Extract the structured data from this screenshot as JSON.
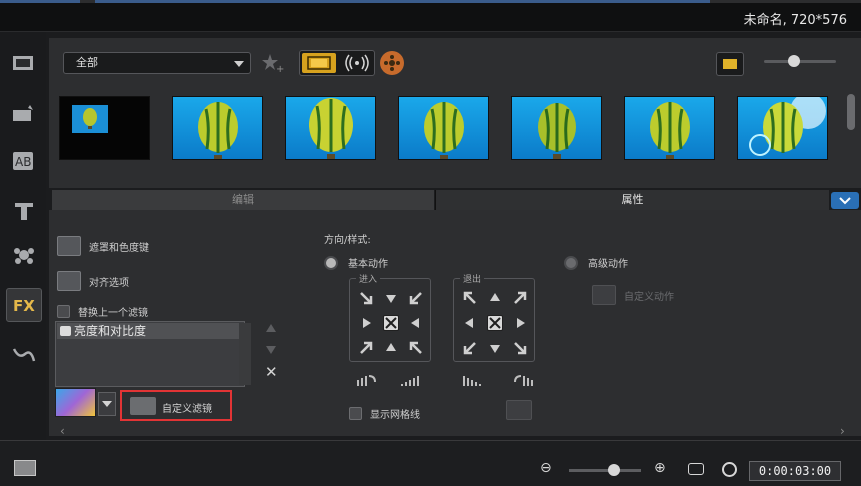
{
  "window": {
    "title": "未命名, 720*576"
  },
  "library": {
    "category": "全部",
    "icons": {
      "add_favorite": "star-plus-icon",
      "show_video": "film-icon",
      "show_audio": "audio-wave-icon",
      "show_graphics": "film-reel-icon",
      "toggle_view": "layout-icon"
    }
  },
  "tabs": {
    "edit": "编辑",
    "attributes": "属性"
  },
  "attributes": {
    "mask_chroma": "遮罩和色度键",
    "align_options": "对齐选项",
    "replace_last_filter": "替换上一个滤镜",
    "filter_item": "亮度和对比度",
    "custom_filter": "自定义滤镜",
    "direction_style": "方向/样式:",
    "basic_motion": "基本动作",
    "advanced_motion": "高级动作",
    "custom_motion": "自定义动作",
    "enter": "进入",
    "exit": "退出",
    "show_grid": "显示网格线"
  },
  "bottom": {
    "timecode": "0:00:03:00"
  },
  "colors": {
    "accent_yellow": "#d7a21e",
    "highlight_red": "#e23435",
    "tab_blue": "#2a6fb5"
  }
}
